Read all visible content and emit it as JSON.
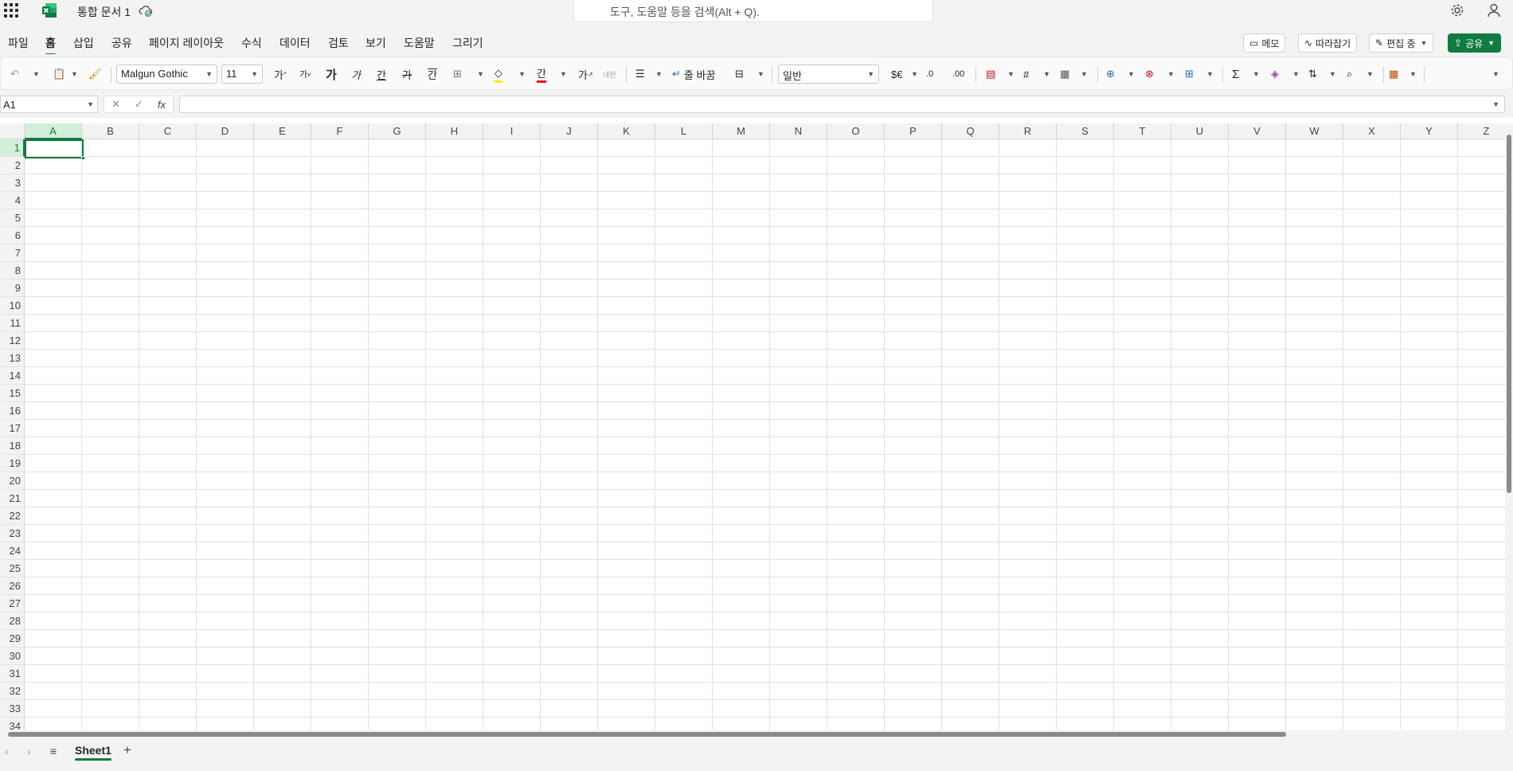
{
  "app": {
    "doc_title": "통합 문서 1",
    "brand_color": "#107c41"
  },
  "search": {
    "placeholder": "도구, 도움말 등을 검색(Alt + Q)."
  },
  "tabs": [
    {
      "label": "파일",
      "active": false
    },
    {
      "label": "홈",
      "active": true
    },
    {
      "label": "삽입",
      "active": false
    },
    {
      "label": "공유",
      "active": false
    },
    {
      "label": "페이지 레이아웃",
      "active": false
    },
    {
      "label": "수식",
      "active": false
    },
    {
      "label": "데이터",
      "active": false
    },
    {
      "label": "검토",
      "active": false
    },
    {
      "label": "보기",
      "active": false
    },
    {
      "label": "도움말",
      "active": false
    },
    {
      "label": "그리기",
      "active": false
    }
  ],
  "actions": {
    "comment": "메모",
    "catch_up": "따라잡기",
    "editing": "편집 중",
    "share": "공유"
  },
  "ribbon": {
    "font_name": "Malgun Gothic",
    "font_size": "11",
    "grow_font": "가",
    "shrink_font": "가",
    "bold": "가",
    "italic": "가",
    "underline": "간",
    "strikethrough": "가",
    "subscript": "간",
    "font_color_glyph": "간",
    "superscript": "가",
    "phonetic": "내천",
    "wrap_text": "줄 바꿈",
    "number_format": "일반",
    "currency": "$€"
  },
  "formula_bar": {
    "name_box": "A1",
    "fx": "fx",
    "value": ""
  },
  "grid": {
    "columns": [
      "A",
      "B",
      "C",
      "D",
      "E",
      "F",
      "G",
      "H",
      "I",
      "J",
      "K",
      "L",
      "M",
      "N",
      "O",
      "P",
      "Q",
      "R",
      "S",
      "T",
      "U",
      "V",
      "W",
      "X",
      "Y",
      "Z"
    ],
    "rows": [
      "1",
      "2",
      "3",
      "4",
      "5",
      "6",
      "7",
      "8",
      "9",
      "10",
      "11",
      "12",
      "13",
      "14",
      "15",
      "16",
      "17",
      "18",
      "19",
      "20",
      "21",
      "22",
      "23",
      "24",
      "25",
      "26",
      "27",
      "28",
      "29",
      "30",
      "31",
      "32",
      "33",
      "34"
    ],
    "active_cell": "A1"
  },
  "sheets": {
    "tabs": [
      "Sheet1"
    ],
    "add": "+"
  },
  "icons": {
    "waffle": "app-launcher-icon",
    "cloud": "cloud-saved-icon",
    "settings": "gear-icon",
    "account": "person-icon"
  }
}
